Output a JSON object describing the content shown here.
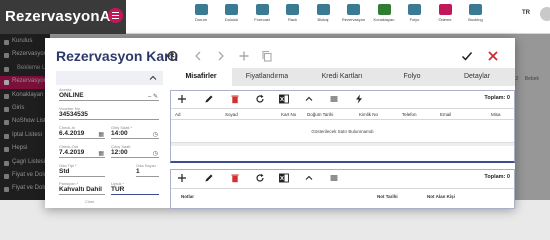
{
  "app": {
    "brand": "RezervasyonAI",
    "language": "TR"
  },
  "top_nav": [
    {
      "label": "Durum",
      "icon": "dashboard-icon"
    },
    {
      "label": "Doluluk",
      "icon": "occupancy-icon"
    },
    {
      "label": "Forecast",
      "icon": "forecast-icon"
    },
    {
      "label": "Rack",
      "icon": "rack-icon"
    },
    {
      "label": "Blokaj",
      "icon": "block-icon"
    },
    {
      "label": "Rezervasyon",
      "icon": "reservation-icon"
    },
    {
      "label": "Konaklayan",
      "icon": "guest-icon"
    },
    {
      "label": "Folyo",
      "icon": "folio-icon"
    },
    {
      "label": "Ödeme",
      "icon": "payment-icon"
    },
    {
      "label": "Booking",
      "icon": "booking-icon"
    }
  ],
  "sidebar": [
    {
      "label": "Kurulus",
      "active": false,
      "sub": false
    },
    {
      "label": "Rezervasyon",
      "active": false,
      "sub": false
    },
    {
      "label": "Bekleme Listesi",
      "active": false,
      "sub": true
    },
    {
      "label": "Rezervasyon",
      "active": true,
      "sub": false
    },
    {
      "label": "Konaklayan",
      "active": false,
      "sub": false
    },
    {
      "label": "Giris",
      "active": false,
      "sub": false
    },
    {
      "label": "NoShow Liste",
      "active": false,
      "sub": false
    },
    {
      "label": "Iptal Listesi",
      "active": false,
      "sub": false
    },
    {
      "label": "Hepsi",
      "active": false,
      "sub": false
    },
    {
      "label": "Çagri Listesi",
      "active": false,
      "sub": false
    },
    {
      "label": "Fiyat ve Doluluk",
      "active": false,
      "sub": false
    },
    {
      "label": "Fiyat ve Doluluk",
      "active": false,
      "sub": false
    }
  ],
  "background_columns": [
    "ik2",
    "Bebek",
    "Ç"
  ],
  "modal": {
    "title": "Rezervasyon Kartı",
    "form": {
      "fields": [
        {
          "label": "Acenta",
          "value": "ONLINE",
          "icon": "– ✎"
        },
        {
          "label": "Voucher No",
          "value": "34534535",
          "icon": ""
        },
        {
          "label": "Check-In",
          "value": "6.4.2019",
          "icon": "▦"
        },
        {
          "label": "Giriş Saati *",
          "value": "14:00",
          "icon": "◷"
        },
        {
          "label": "Check-Out",
          "value": "7.4.2019",
          "icon": "▦"
        },
        {
          "label": "Çıkış Saati",
          "value": "12:00",
          "icon": "◷"
        },
        {
          "label": "Oda Tipi *",
          "value": "Std",
          "icon": ""
        },
        {
          "label": "Oda Sayısı",
          "value": "1",
          "icon": ""
        },
        {
          "label": "Pansiyon *",
          "value": "Kahvaltı Dahil",
          "icon": ""
        },
        {
          "label": "Uyruk *",
          "value": "TUR",
          "icon": ""
        },
        {
          "label": "Cinsi",
          "value": "",
          "icon": ""
        }
      ]
    },
    "tabs": [
      "Misafirler",
      "Fiyatlandırma",
      "Kredi Kartları",
      "Folyo",
      "Detaylar"
    ],
    "active_tab": 0,
    "grid1": {
      "count_label": "Toplam: 0",
      "columns": [
        "Ad",
        "Soyad",
        "Kart No",
        "Doğum Tarihi",
        "Kimlik No",
        "Telefon",
        "Email",
        "Misa"
      ],
      "empty_text": "Gösterilecek Satır Bulunmamdı"
    },
    "grid2": {
      "count_label": "Toplam: 0",
      "columns": [
        "Notlar",
        "Not Tarihi",
        "Not Alan Kişi"
      ]
    }
  }
}
